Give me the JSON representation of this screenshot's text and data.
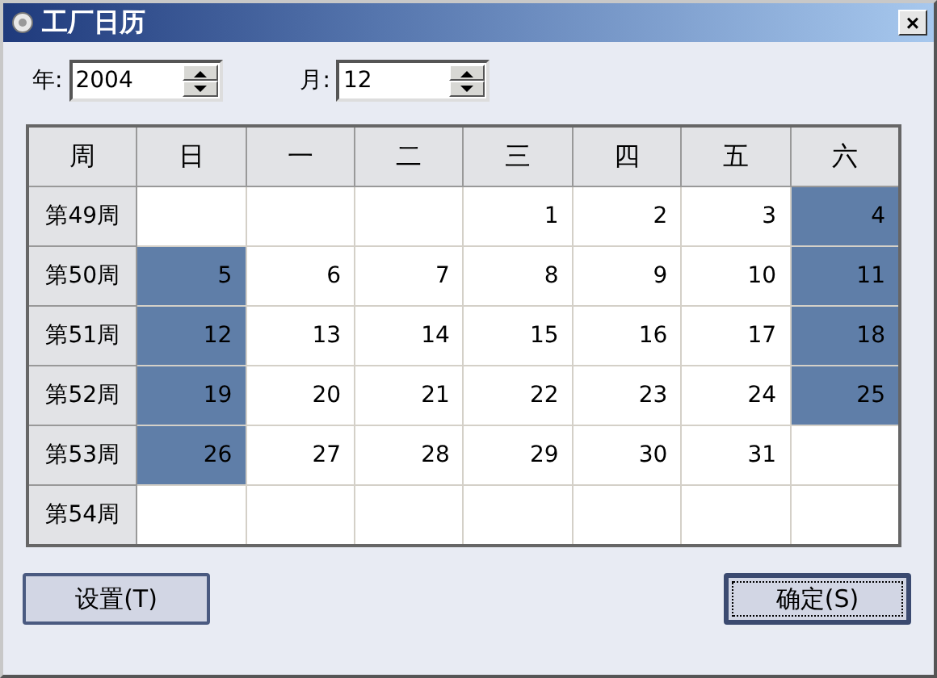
{
  "window": {
    "title": "工厂日历",
    "close": "×"
  },
  "year": {
    "label": "年:",
    "value": "2004"
  },
  "month": {
    "label": "月:",
    "value": "12"
  },
  "calendar": {
    "columns": [
      "周",
      "日",
      "一",
      "二",
      "三",
      "四",
      "五",
      "六"
    ],
    "rows": [
      {
        "week": "第49周",
        "days": [
          {
            "highlighted": false
          },
          {
            "highlighted": false
          },
          {
            "highlighted": false
          },
          {
            "day": "1",
            "highlighted": false
          },
          {
            "day": "2",
            "highlighted": false
          },
          {
            "day": "3",
            "highlighted": false
          },
          {
            "day": "4",
            "highlighted": true
          }
        ]
      },
      {
        "week": "第50周",
        "days": [
          {
            "day": "5",
            "highlighted": true
          },
          {
            "day": "6",
            "highlighted": false
          },
          {
            "day": "7",
            "highlighted": false
          },
          {
            "day": "8",
            "highlighted": false
          },
          {
            "day": "9",
            "highlighted": false
          },
          {
            "day": "10",
            "highlighted": false
          },
          {
            "day": "11",
            "highlighted": true
          }
        ]
      },
      {
        "week": "第51周",
        "days": [
          {
            "day": "12",
            "highlighted": true
          },
          {
            "day": "13",
            "highlighted": false
          },
          {
            "day": "14",
            "highlighted": false
          },
          {
            "day": "15",
            "highlighted": false
          },
          {
            "day": "16",
            "highlighted": false
          },
          {
            "day": "17",
            "highlighted": false
          },
          {
            "day": "18",
            "highlighted": true
          }
        ]
      },
      {
        "week": "第52周",
        "days": [
          {
            "day": "19",
            "highlighted": true
          },
          {
            "day": "20",
            "highlighted": false
          },
          {
            "day": "21",
            "highlighted": false
          },
          {
            "day": "22",
            "highlighted": false
          },
          {
            "day": "23",
            "highlighted": false
          },
          {
            "day": "24",
            "highlighted": false
          },
          {
            "day": "25",
            "highlighted": true
          }
        ]
      },
      {
        "week": "第53周",
        "days": [
          {
            "day": "26",
            "highlighted": true
          },
          {
            "day": "27",
            "highlighted": false
          },
          {
            "day": "28",
            "highlighted": false
          },
          {
            "day": "29",
            "highlighted": false
          },
          {
            "day": "30",
            "highlighted": false
          },
          {
            "day": "31",
            "highlighted": false
          },
          {
            "highlighted": false
          }
        ]
      },
      {
        "week": "第54周",
        "days": [
          {
            "highlighted": false
          },
          {
            "highlighted": false
          },
          {
            "highlighted": false
          },
          {
            "highlighted": false
          },
          {
            "highlighted": false
          },
          {
            "highlighted": false
          },
          {
            "highlighted": false
          }
        ]
      }
    ]
  },
  "buttons": [
    "设置(T)",
    "确定(S)"
  ]
}
